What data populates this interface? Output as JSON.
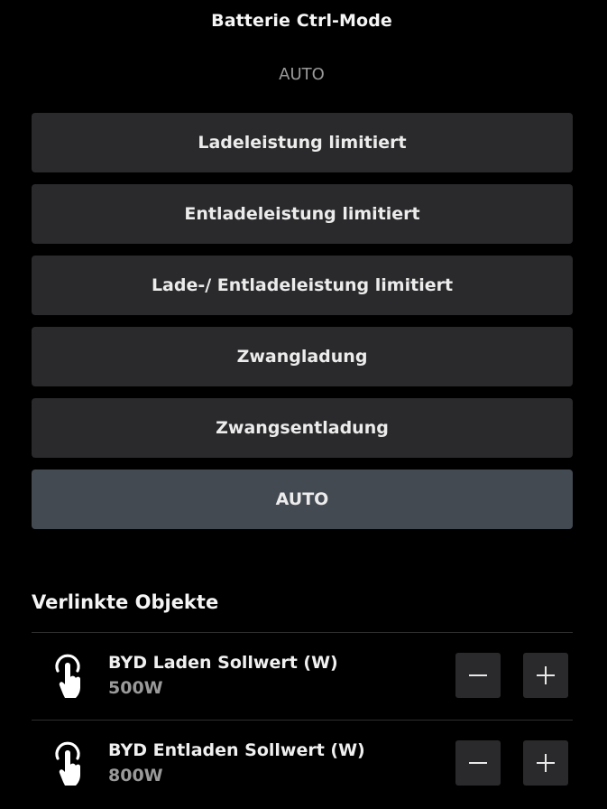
{
  "header": {
    "title": "Batterie Ctrl-Mode",
    "current_mode": "AUTO"
  },
  "modes": [
    {
      "label": "Ladeleistung limitiert",
      "active": false
    },
    {
      "label": "Entladeleistung limitiert",
      "active": false
    },
    {
      "label": "Lade-/ Entladeleistung limitiert",
      "active": false
    },
    {
      "label": "Zwangladung",
      "active": false
    },
    {
      "label": "Zwangsentladung",
      "active": false
    },
    {
      "label": "AUTO",
      "active": true
    }
  ],
  "linked": {
    "title": "Verlinkte Objekte",
    "items": [
      {
        "name": "BYD Laden Sollwert (W)",
        "value": "500W",
        "icon": "touch-hand-icon"
      },
      {
        "name": "BYD Entladen Sollwert (W)",
        "value": "800W",
        "icon": "touch-hand-icon"
      }
    ]
  },
  "colors": {
    "background": "#000000",
    "button": "#2a2a2c",
    "active_button": "#434a52",
    "muted_text": "#9a9a9a"
  }
}
